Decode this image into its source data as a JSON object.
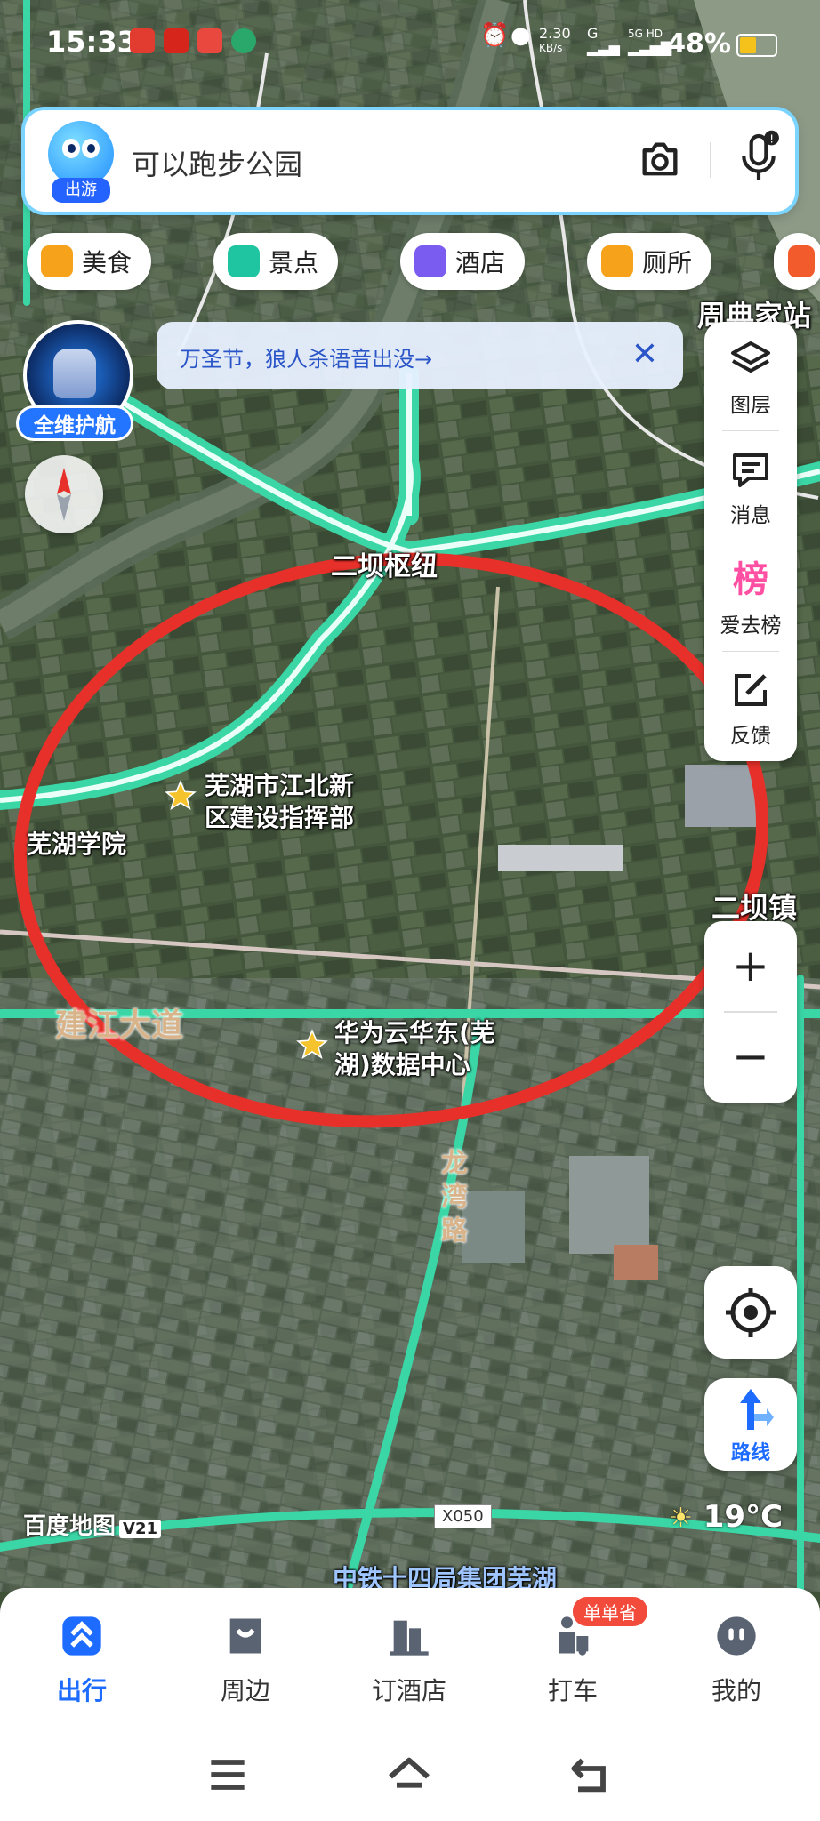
{
  "status_bar": {
    "time": "15:33",
    "net_speed": "2.30",
    "net_unit": "KB/s",
    "network_g": "G",
    "network_5g": "5G HD",
    "battery": "48%"
  },
  "search": {
    "badge_label": "出游",
    "placeholder": "可以跑步公园",
    "camera_icon": "camera-icon",
    "mic_icon": "microphone-icon"
  },
  "categories": [
    {
      "label": "美食",
      "icon": "food-icon",
      "color": "#f7a21b"
    },
    {
      "label": "景点",
      "icon": "scenic-icon",
      "color": "#1fc4a0"
    },
    {
      "label": "酒店",
      "icon": "hotel-icon",
      "color": "#7b5cf0"
    },
    {
      "label": "厕所",
      "icon": "toilet-icon",
      "color": "#f7a21b"
    }
  ],
  "banner": {
    "text": "万圣节，狼人杀语音出没→",
    "close": "✕"
  },
  "nav3d": {
    "label": "全维护航"
  },
  "right_panel": [
    {
      "label": "图层",
      "icon": "layers-icon"
    },
    {
      "label": "消息",
      "icon": "message-icon"
    },
    {
      "label": "爱去榜",
      "icon": "ranking-icon",
      "glyph": "榜"
    },
    {
      "label": "反馈",
      "icon": "feedback-icon"
    }
  ],
  "zoom": {
    "in": "+",
    "out": "−"
  },
  "route": {
    "label": "路线"
  },
  "map_labels": {
    "hub": "二坝枢纽",
    "station": "周典家站",
    "poi1_line1": "芜湖市江北新",
    "poi1_line2": "区建设指挥部",
    "college": "芜湖学院",
    "town": "二坝镇",
    "avenue": "建江大道",
    "poi2_line1": "华为云华东(芜",
    "poi2_line2": "湖)数据中心",
    "road_vertical": [
      "龙",
      "湾",
      "路"
    ],
    "company": "中铁十四局集团芜湖",
    "route_code": "X050"
  },
  "map_footer": {
    "brand": "百度地图",
    "version": "V21",
    "temperature": "19°C"
  },
  "tabbar": {
    "tabs": [
      {
        "label": "出行",
        "icon": "travel-icon",
        "active": true
      },
      {
        "label": "周边",
        "icon": "nearby-icon",
        "active": false
      },
      {
        "label": "订酒店",
        "icon": "hotel-booking-icon",
        "active": false
      },
      {
        "label": "打车",
        "icon": "taxi-icon",
        "active": false
      },
      {
        "label": "我的",
        "icon": "profile-icon",
        "active": false
      }
    ],
    "taxi_badge": "单单省"
  },
  "colors": {
    "accent": "#1e6cff",
    "route_green": "#3ad6a6",
    "annotation_red": "#e8302a",
    "badge_red": "#f24a3b"
  }
}
